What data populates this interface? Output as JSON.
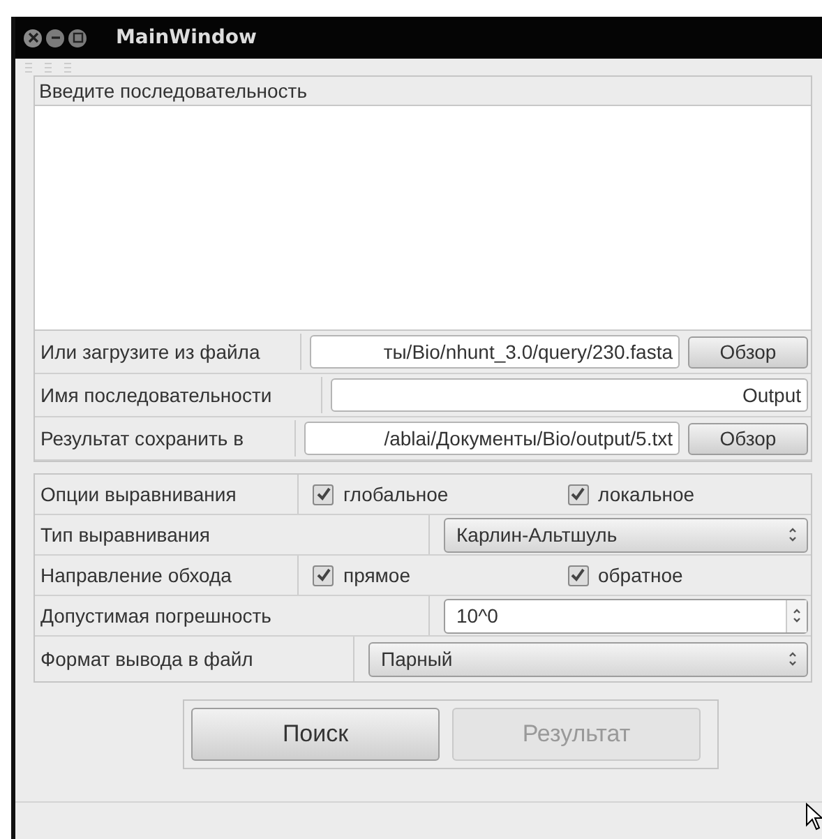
{
  "window": {
    "title": "MainWindow"
  },
  "sequence_panel": {
    "title": "Введите последовательность"
  },
  "file_rows": [
    {
      "kind": "path",
      "label": "Или загрузите из файла",
      "value": "ты/Bio/nhunt_3.0/query/230.fasta",
      "button": "Обзор"
    },
    {
      "kind": "name",
      "label": "Имя последовательности",
      "value": "Output"
    },
    {
      "kind": "path",
      "label": "Результат сохранить в",
      "value": "/ablai/Документы/Bio/output/5.txt",
      "button": "Обзор"
    }
  ],
  "option_rows": [
    {
      "kind": "checks",
      "label": "Опции выравнивания",
      "options": [
        {
          "label": "глобальное",
          "checked": true
        },
        {
          "label": "локальное",
          "checked": true
        }
      ]
    },
    {
      "kind": "combo",
      "label": "Тип выравнивания",
      "value": "Карлин-Альтшуль"
    },
    {
      "kind": "checks",
      "label": "Направление обхода",
      "options": [
        {
          "label": "прямое",
          "checked": true
        },
        {
          "label": "обратное",
          "checked": true
        }
      ]
    },
    {
      "kind": "spin",
      "label": "Допустимая погрешность",
      "value": "10^0"
    },
    {
      "kind": "combo",
      "label": "Формат вывода в файл",
      "value": "Парный"
    }
  ],
  "buttons": [
    {
      "label": "Поиск",
      "disabled": false
    },
    {
      "label": "Результат",
      "disabled": true
    }
  ]
}
